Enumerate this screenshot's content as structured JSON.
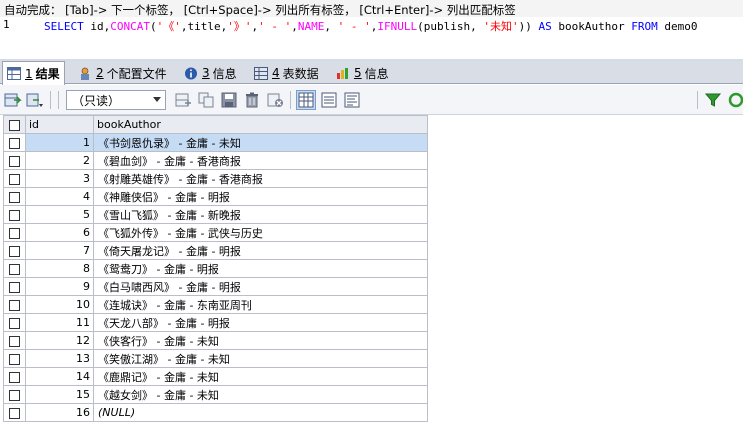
{
  "hint": "自动完成： [Tab]-> 下一个标签， [Ctrl+Space]-> 列出所有标签， [Ctrl+Enter]-> 列出匹配标签",
  "editor": {
    "line_number": "1",
    "tokens": [
      {
        "t": "SELECT",
        "c": "kw"
      },
      {
        "t": " id,",
        "c": "pl"
      },
      {
        "t": "CONCAT",
        "c": "fn"
      },
      {
        "t": "(",
        "c": "pl"
      },
      {
        "t": "'《'",
        "c": "str"
      },
      {
        "t": ",title,",
        "c": "pl"
      },
      {
        "t": "'》'",
        "c": "str"
      },
      {
        "t": ",",
        "c": "pl"
      },
      {
        "t": "' - '",
        "c": "str"
      },
      {
        "t": ",",
        "c": "pl"
      },
      {
        "t": "NAME",
        "c": "fn"
      },
      {
        "t": ", ",
        "c": "pl"
      },
      {
        "t": "' - '",
        "c": "str"
      },
      {
        "t": ",",
        "c": "pl"
      },
      {
        "t": "IFNULL",
        "c": "fn"
      },
      {
        "t": "(publish, ",
        "c": "pl"
      },
      {
        "t": "'未知'",
        "c": "str"
      },
      {
        "t": ")) ",
        "c": "pl"
      },
      {
        "t": "AS",
        "c": "kw"
      },
      {
        "t": " bookAuthor ",
        "c": "pl"
      },
      {
        "t": "FROM",
        "c": "kw"
      },
      {
        "t": " demo0",
        "c": "pl"
      }
    ]
  },
  "tabs": [
    {
      "num": "1",
      "label": "结果",
      "icon": "result-grid-icon",
      "active": true
    },
    {
      "num": "2",
      "label": "个配置文件",
      "icon": "profile-icon",
      "active": false
    },
    {
      "num": "3",
      "label": "信息",
      "icon": "info-icon",
      "active": false
    },
    {
      "num": "4",
      "label": "表数据",
      "icon": "table-data-icon",
      "active": false
    },
    {
      "num": "5",
      "label": "信息",
      "icon": "info-chart-icon",
      "active": false
    }
  ],
  "toolbar": {
    "view_mode": "（只读）"
  },
  "colors": {
    "keyword": "#0000ff",
    "function": "#ff00ff",
    "string": "#ff0000",
    "selected_row": "#c6dcf5",
    "filter_icon": "#2e9a2e"
  },
  "grid": {
    "columns": [
      "id",
      "bookAuthor"
    ],
    "rows": [
      {
        "id": "1",
        "bookAuthor": "《书剑恩仇录》 - 金庸 - 未知",
        "selected": true
      },
      {
        "id": "2",
        "bookAuthor": "《碧血剑》 - 金庸 - 香港商报"
      },
      {
        "id": "3",
        "bookAuthor": "《射雕英雄传》 - 金庸 - 香港商报"
      },
      {
        "id": "4",
        "bookAuthor": "《神雕侠侣》 - 金庸 - 明报"
      },
      {
        "id": "5",
        "bookAuthor": "《雪山飞狐》 - 金庸 - 新晚报"
      },
      {
        "id": "6",
        "bookAuthor": "《飞狐外传》 - 金庸 - 武侠与历史"
      },
      {
        "id": "7",
        "bookAuthor": "《倚天屠龙记》 - 金庸 - 明报"
      },
      {
        "id": "8",
        "bookAuthor": "《鸳鸯刀》 - 金庸 - 明报"
      },
      {
        "id": "9",
        "bookAuthor": "《白马啸西风》 - 金庸 - 明报"
      },
      {
        "id": "10",
        "bookAuthor": "《连城诀》 - 金庸 - 东南亚周刊"
      },
      {
        "id": "11",
        "bookAuthor": "《天龙八部》 - 金庸 - 明报"
      },
      {
        "id": "12",
        "bookAuthor": "《侠客行》 - 金庸 - 未知"
      },
      {
        "id": "13",
        "bookAuthor": "《笑傲江湖》 - 金庸 - 未知"
      },
      {
        "id": "14",
        "bookAuthor": "《鹿鼎记》 - 金庸 - 未知"
      },
      {
        "id": "15",
        "bookAuthor": "《越女剑》 - 金庸 - 未知"
      },
      {
        "id": "16",
        "bookAuthor": "(NULL)",
        "null": true
      }
    ]
  }
}
